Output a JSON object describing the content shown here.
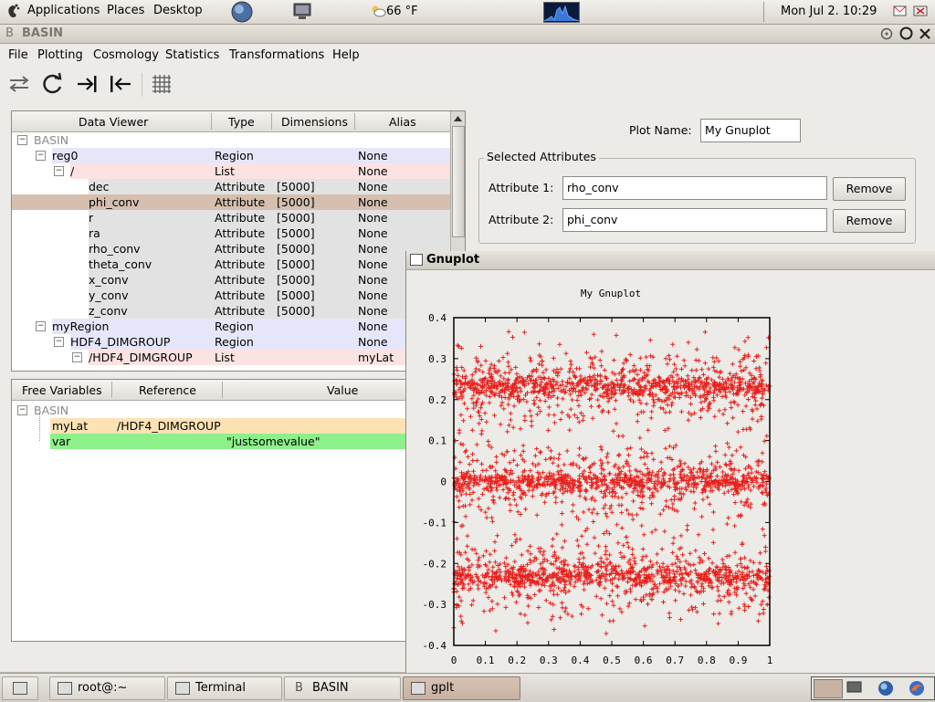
{
  "top_panel": {
    "menus": [
      "Applications",
      "Places",
      "Desktop"
    ],
    "weather": "66 °F",
    "clock": "Mon Jul  2. 10:29"
  },
  "basin": {
    "title": "BASIN",
    "menu": [
      "File",
      "Plotting",
      "Cosmology",
      "Statistics",
      "Transformations",
      "Help"
    ],
    "data_viewer": {
      "columns": [
        "Data Viewer",
        "Type",
        "Dimensions",
        "Alias"
      ],
      "rows": [
        {
          "name": "BASIN",
          "type": "",
          "dims": "",
          "alias": ""
        },
        {
          "name": "reg0",
          "type": "Region",
          "dims": "",
          "alias": "None"
        },
        {
          "name": "/",
          "type": "List",
          "dims": "",
          "alias": "None"
        },
        {
          "name": "dec",
          "type": "Attribute",
          "dims": "[5000]",
          "alias": "None"
        },
        {
          "name": "phi_conv",
          "type": "Attribute",
          "dims": "[5000]",
          "alias": "None"
        },
        {
          "name": "r",
          "type": "Attribute",
          "dims": "[5000]",
          "alias": "None"
        },
        {
          "name": "ra",
          "type": "Attribute",
          "dims": "[5000]",
          "alias": "None"
        },
        {
          "name": "rho_conv",
          "type": "Attribute",
          "dims": "[5000]",
          "alias": "None"
        },
        {
          "name": "theta_conv",
          "type": "Attribute",
          "dims": "[5000]",
          "alias": "None"
        },
        {
          "name": "x_conv",
          "type": "Attribute",
          "dims": "[5000]",
          "alias": "None"
        },
        {
          "name": "y_conv",
          "type": "Attribute",
          "dims": "[5000]",
          "alias": "None"
        },
        {
          "name": "z_conv",
          "type": "Attribute",
          "dims": "[5000]",
          "alias": "None"
        },
        {
          "name": "myRegion",
          "type": "Region",
          "dims": "",
          "alias": "None"
        },
        {
          "name": "HDF4_DIMGROUP",
          "type": "Region",
          "dims": "",
          "alias": "None"
        },
        {
          "name": "/HDF4_DIMGROUP",
          "type": "List",
          "dims": "",
          "alias": "myLat"
        }
      ]
    },
    "free_vars": {
      "columns": [
        "Free Variables",
        "Reference",
        "Value"
      ],
      "root": "BASIN",
      "rows": [
        {
          "name": "myLat",
          "reference": "/HDF4_DIMGROUP",
          "value": ""
        },
        {
          "name": "var",
          "reference": "",
          "value": "\"justsomevalue\""
        }
      ]
    },
    "plot_name_label": "Plot Name:",
    "plot_name_value": "My Gnuplot",
    "selected_attrs_label": "Selected Attributes",
    "attr1_label": "Attribute 1:",
    "attr1_value": "rho_conv",
    "attr2_label": "Attribute 2:",
    "attr2_value": "phi_conv",
    "remove_label": "Remove"
  },
  "gnuplot": {
    "window_title": "Gnuplot",
    "chart_data": {
      "type": "scatter",
      "title": "My Gnuplot",
      "xlim": [
        0,
        1
      ],
      "ylim": [
        -0.4,
        0.4
      ],
      "x_ticks": [
        "0",
        "0.1",
        "0.2",
        "0.3",
        "0.4",
        "0.5",
        "0.6",
        "0.7",
        "0.8",
        "0.9",
        "1"
      ],
      "y_ticks": [
        "0.4",
        "0.3",
        "0.2",
        "0.1",
        "0",
        "-0.1",
        "-0.2",
        "-0.3",
        "-0.4"
      ],
      "marker": "+",
      "color": "#e8201c",
      "bands": [
        {
          "center": 0.232,
          "spread": 0.05
        },
        {
          "center": 0.0,
          "spread": 0.05
        },
        {
          "center": -0.232,
          "spread": 0.05
        }
      ]
    }
  },
  "taskbar": {
    "tasks": [
      "root@:~",
      "Terminal",
      "BASIN",
      "gplt"
    ]
  }
}
